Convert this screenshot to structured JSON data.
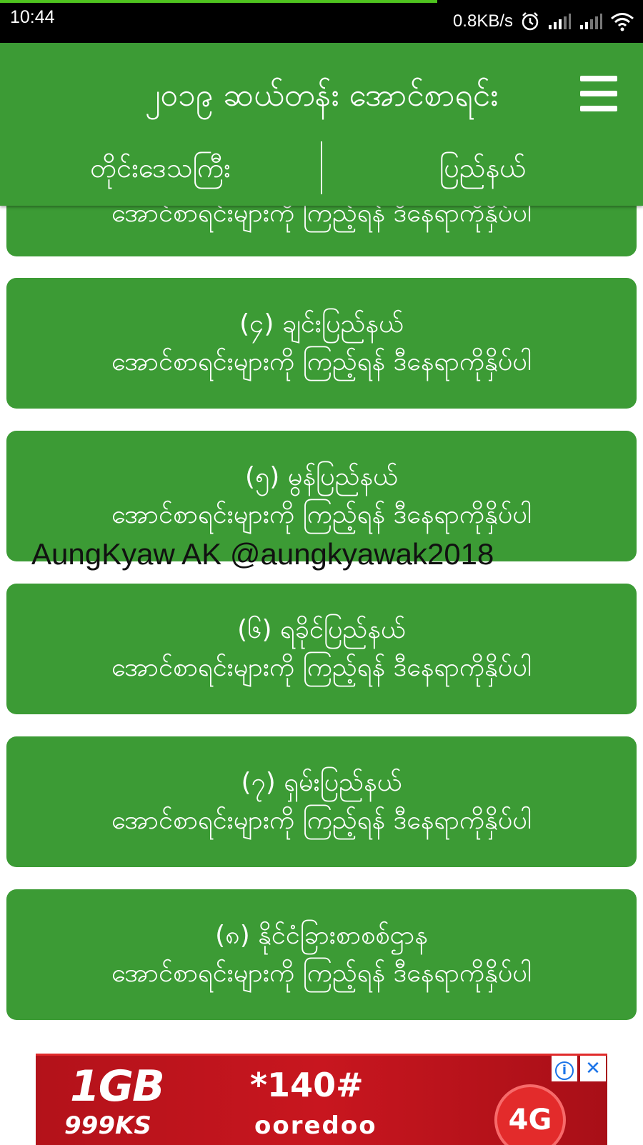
{
  "status_bar": {
    "time": "10:44",
    "net_speed": "0.8KB/s",
    "icons": [
      "alarm-icon",
      "signal-icon",
      "signal-icon",
      "wifi-icon"
    ],
    "progress": 0.68
  },
  "app_bar": {
    "title": "၂၀၁၉ ဆယ်တန်း အောင်စာရင်း",
    "menu_icon": "hamburger-menu-icon",
    "tabs": [
      {
        "label": "တိုင်းဒေသကြီး"
      },
      {
        "label": "ပြည်နယ်"
      }
    ]
  },
  "cards": [
    {
      "title": "",
      "subtitle": "အောင်စာရင်းများကို ကြည့်ရန် ဒီနေရာကိုနှိပ်ပါ"
    },
    {
      "title": "(၄) ချင်းပြည်နယ်",
      "subtitle": "အောင်စာရင်းများကို ကြည့်ရန် ဒီနေရာကိုနှိပ်ပါ"
    },
    {
      "title": "(၅) မွန်ပြည်နယ်",
      "subtitle": "အောင်စာရင်းများကို ကြည့်ရန် ဒီနေရာကိုနှိပ်ပါ"
    },
    {
      "title": "(၆) ရခိုင်ပြည်နယ်",
      "subtitle": "အောင်စာရင်းများကို ကြည့်ရန် ဒီနေရာကိုနှိပ်ပါ"
    },
    {
      "title": "(၇) ရှမ်းပြည်နယ်",
      "subtitle": "အောင်စာရင်းများကို ကြည့်ရန် ဒီနေရာကိုနှိပ်ပါ"
    },
    {
      "title": "(၈) နိုင်ငံခြားစာစစ်ဌာန",
      "subtitle": "အောင်စာရင်းများကို ကြည့်ရန် ဒီနေရာကိုနှိပ်ပါ"
    }
  ],
  "watermark": "AungKyaw AK @aungkyawak2018",
  "ad": {
    "headline": "1GB",
    "price": "999KS",
    "code": "*140#",
    "brand": "ooredoo",
    "badge": "4G",
    "info_icon": "i",
    "close_icon": "✕"
  },
  "colors": {
    "primary_green": "#3c9b35",
    "status_bar": "#000000",
    "ad_red": "#c8161f"
  }
}
